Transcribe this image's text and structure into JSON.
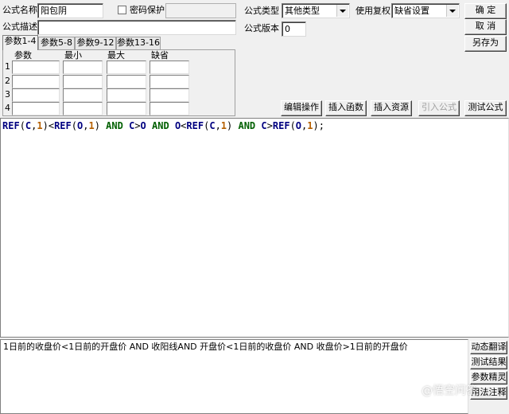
{
  "form": {
    "name_label": "公式名称",
    "name_value": "阳包阴",
    "password_label": "密码保护",
    "desc_label": "公式描述",
    "desc_value": "",
    "type_label": "公式类型",
    "type_value": "其他类型",
    "fq_label": "使用复权",
    "fq_value": "缺省设置",
    "version_label": "公式版本",
    "version_value": "0"
  },
  "buttons": {
    "ok": "确 定",
    "cancel": "取 消",
    "save_as": "另存为",
    "edit_op": "编辑操作",
    "insert_func": "插入函数",
    "insert_res": "插入资源",
    "import_formula": "引入公式",
    "test_formula": "测试公式",
    "dynamic_translate": "动态翻译",
    "test_result": "测试结果",
    "param_wizard": "参数精灵",
    "usage_notes": "用法注释"
  },
  "tabs": [
    "参数1-4",
    "参数5-8",
    "参数9-12",
    "参数13-16"
  ],
  "param_table": {
    "headers": [
      "参数",
      "最小",
      "最大",
      "缺省"
    ],
    "rows": [
      "1",
      "2",
      "3",
      "4"
    ]
  },
  "editor": {
    "code": "REF(C,1)<REF(O,1) AND C>O AND O<REF(C,1) AND C>REF(O,1);"
  },
  "translation": {
    "text": "1日前的收盘价<1日前的开盘价 AND 收阳线AND 开盘价<1日前的收盘价 AND 收盘价>1日前的开盘价"
  },
  "watermark": {
    "text": "@悟空问答"
  },
  "icons": [
    "checkbox-icon",
    "chevron-down-icon"
  ]
}
